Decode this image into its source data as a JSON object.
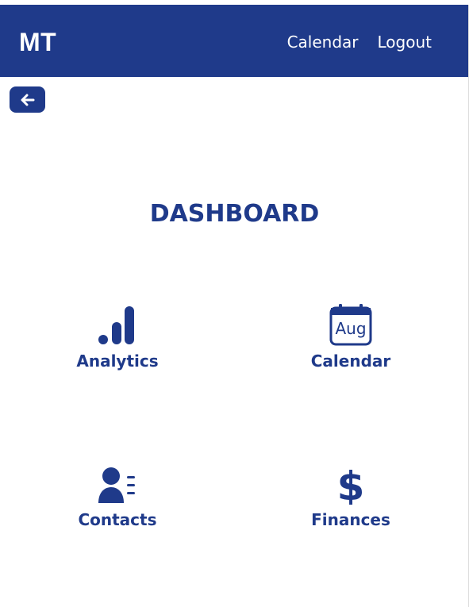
{
  "navbar": {
    "brand": "MT",
    "links": [
      "Calendar",
      "Logout"
    ]
  },
  "back_button": {
    "icon": "arrow-left-icon"
  },
  "dashboard": {
    "title": "DASHBOARD",
    "tiles": [
      {
        "label": "Analytics",
        "icon": "bar-chart-icon"
      },
      {
        "label": "Calendar",
        "icon": "calendar-icon",
        "icon_text": "Aug"
      },
      {
        "label": "Contacts",
        "icon": "contacts-icon"
      },
      {
        "label": "Finances",
        "icon": "dollar-icon",
        "icon_text": "$"
      }
    ]
  },
  "colors": {
    "primary": "#1f3a8a",
    "background": "#ffffff",
    "nav_text": "#ffffff"
  }
}
